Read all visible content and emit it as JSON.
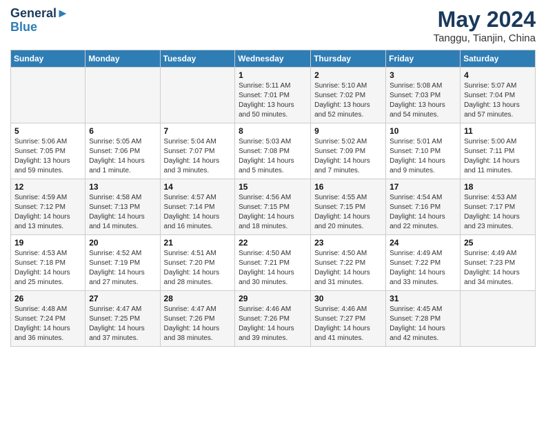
{
  "header": {
    "logo_line1": "General",
    "logo_line2": "Blue",
    "month": "May 2024",
    "location": "Tanggu, Tianjin, China"
  },
  "weekdays": [
    "Sunday",
    "Monday",
    "Tuesday",
    "Wednesday",
    "Thursday",
    "Friday",
    "Saturday"
  ],
  "weeks": [
    [
      {
        "day": "",
        "sunrise": "",
        "sunset": "",
        "daylight": ""
      },
      {
        "day": "",
        "sunrise": "",
        "sunset": "",
        "daylight": ""
      },
      {
        "day": "",
        "sunrise": "",
        "sunset": "",
        "daylight": ""
      },
      {
        "day": "1",
        "sunrise": "Sunrise: 5:11 AM",
        "sunset": "Sunset: 7:01 PM",
        "daylight": "Daylight: 13 hours and 50 minutes."
      },
      {
        "day": "2",
        "sunrise": "Sunrise: 5:10 AM",
        "sunset": "Sunset: 7:02 PM",
        "daylight": "Daylight: 13 hours and 52 minutes."
      },
      {
        "day": "3",
        "sunrise": "Sunrise: 5:08 AM",
        "sunset": "Sunset: 7:03 PM",
        "daylight": "Daylight: 13 hours and 54 minutes."
      },
      {
        "day": "4",
        "sunrise": "Sunrise: 5:07 AM",
        "sunset": "Sunset: 7:04 PM",
        "daylight": "Daylight: 13 hours and 57 minutes."
      }
    ],
    [
      {
        "day": "5",
        "sunrise": "Sunrise: 5:06 AM",
        "sunset": "Sunset: 7:05 PM",
        "daylight": "Daylight: 13 hours and 59 minutes."
      },
      {
        "day": "6",
        "sunrise": "Sunrise: 5:05 AM",
        "sunset": "Sunset: 7:06 PM",
        "daylight": "Daylight: 14 hours and 1 minute."
      },
      {
        "day": "7",
        "sunrise": "Sunrise: 5:04 AM",
        "sunset": "Sunset: 7:07 PM",
        "daylight": "Daylight: 14 hours and 3 minutes."
      },
      {
        "day": "8",
        "sunrise": "Sunrise: 5:03 AM",
        "sunset": "Sunset: 7:08 PM",
        "daylight": "Daylight: 14 hours and 5 minutes."
      },
      {
        "day": "9",
        "sunrise": "Sunrise: 5:02 AM",
        "sunset": "Sunset: 7:09 PM",
        "daylight": "Daylight: 14 hours and 7 minutes."
      },
      {
        "day": "10",
        "sunrise": "Sunrise: 5:01 AM",
        "sunset": "Sunset: 7:10 PM",
        "daylight": "Daylight: 14 hours and 9 minutes."
      },
      {
        "day": "11",
        "sunrise": "Sunrise: 5:00 AM",
        "sunset": "Sunset: 7:11 PM",
        "daylight": "Daylight: 14 hours and 11 minutes."
      }
    ],
    [
      {
        "day": "12",
        "sunrise": "Sunrise: 4:59 AM",
        "sunset": "Sunset: 7:12 PM",
        "daylight": "Daylight: 14 hours and 13 minutes."
      },
      {
        "day": "13",
        "sunrise": "Sunrise: 4:58 AM",
        "sunset": "Sunset: 7:13 PM",
        "daylight": "Daylight: 14 hours and 14 minutes."
      },
      {
        "day": "14",
        "sunrise": "Sunrise: 4:57 AM",
        "sunset": "Sunset: 7:14 PM",
        "daylight": "Daylight: 14 hours and 16 minutes."
      },
      {
        "day": "15",
        "sunrise": "Sunrise: 4:56 AM",
        "sunset": "Sunset: 7:15 PM",
        "daylight": "Daylight: 14 hours and 18 minutes."
      },
      {
        "day": "16",
        "sunrise": "Sunrise: 4:55 AM",
        "sunset": "Sunset: 7:15 PM",
        "daylight": "Daylight: 14 hours and 20 minutes."
      },
      {
        "day": "17",
        "sunrise": "Sunrise: 4:54 AM",
        "sunset": "Sunset: 7:16 PM",
        "daylight": "Daylight: 14 hours and 22 minutes."
      },
      {
        "day": "18",
        "sunrise": "Sunrise: 4:53 AM",
        "sunset": "Sunset: 7:17 PM",
        "daylight": "Daylight: 14 hours and 23 minutes."
      }
    ],
    [
      {
        "day": "19",
        "sunrise": "Sunrise: 4:53 AM",
        "sunset": "Sunset: 7:18 PM",
        "daylight": "Daylight: 14 hours and 25 minutes."
      },
      {
        "day": "20",
        "sunrise": "Sunrise: 4:52 AM",
        "sunset": "Sunset: 7:19 PM",
        "daylight": "Daylight: 14 hours and 27 minutes."
      },
      {
        "day": "21",
        "sunrise": "Sunrise: 4:51 AM",
        "sunset": "Sunset: 7:20 PM",
        "daylight": "Daylight: 14 hours and 28 minutes."
      },
      {
        "day": "22",
        "sunrise": "Sunrise: 4:50 AM",
        "sunset": "Sunset: 7:21 PM",
        "daylight": "Daylight: 14 hours and 30 minutes."
      },
      {
        "day": "23",
        "sunrise": "Sunrise: 4:50 AM",
        "sunset": "Sunset: 7:22 PM",
        "daylight": "Daylight: 14 hours and 31 minutes."
      },
      {
        "day": "24",
        "sunrise": "Sunrise: 4:49 AM",
        "sunset": "Sunset: 7:22 PM",
        "daylight": "Daylight: 14 hours and 33 minutes."
      },
      {
        "day": "25",
        "sunrise": "Sunrise: 4:49 AM",
        "sunset": "Sunset: 7:23 PM",
        "daylight": "Daylight: 14 hours and 34 minutes."
      }
    ],
    [
      {
        "day": "26",
        "sunrise": "Sunrise: 4:48 AM",
        "sunset": "Sunset: 7:24 PM",
        "daylight": "Daylight: 14 hours and 36 minutes."
      },
      {
        "day": "27",
        "sunrise": "Sunrise: 4:47 AM",
        "sunset": "Sunset: 7:25 PM",
        "daylight": "Daylight: 14 hours and 37 minutes."
      },
      {
        "day": "28",
        "sunrise": "Sunrise: 4:47 AM",
        "sunset": "Sunset: 7:26 PM",
        "daylight": "Daylight: 14 hours and 38 minutes."
      },
      {
        "day": "29",
        "sunrise": "Sunrise: 4:46 AM",
        "sunset": "Sunset: 7:26 PM",
        "daylight": "Daylight: 14 hours and 39 minutes."
      },
      {
        "day": "30",
        "sunrise": "Sunrise: 4:46 AM",
        "sunset": "Sunset: 7:27 PM",
        "daylight": "Daylight: 14 hours and 41 minutes."
      },
      {
        "day": "31",
        "sunrise": "Sunrise: 4:45 AM",
        "sunset": "Sunset: 7:28 PM",
        "daylight": "Daylight: 14 hours and 42 minutes."
      },
      {
        "day": "",
        "sunrise": "",
        "sunset": "",
        "daylight": ""
      }
    ]
  ]
}
